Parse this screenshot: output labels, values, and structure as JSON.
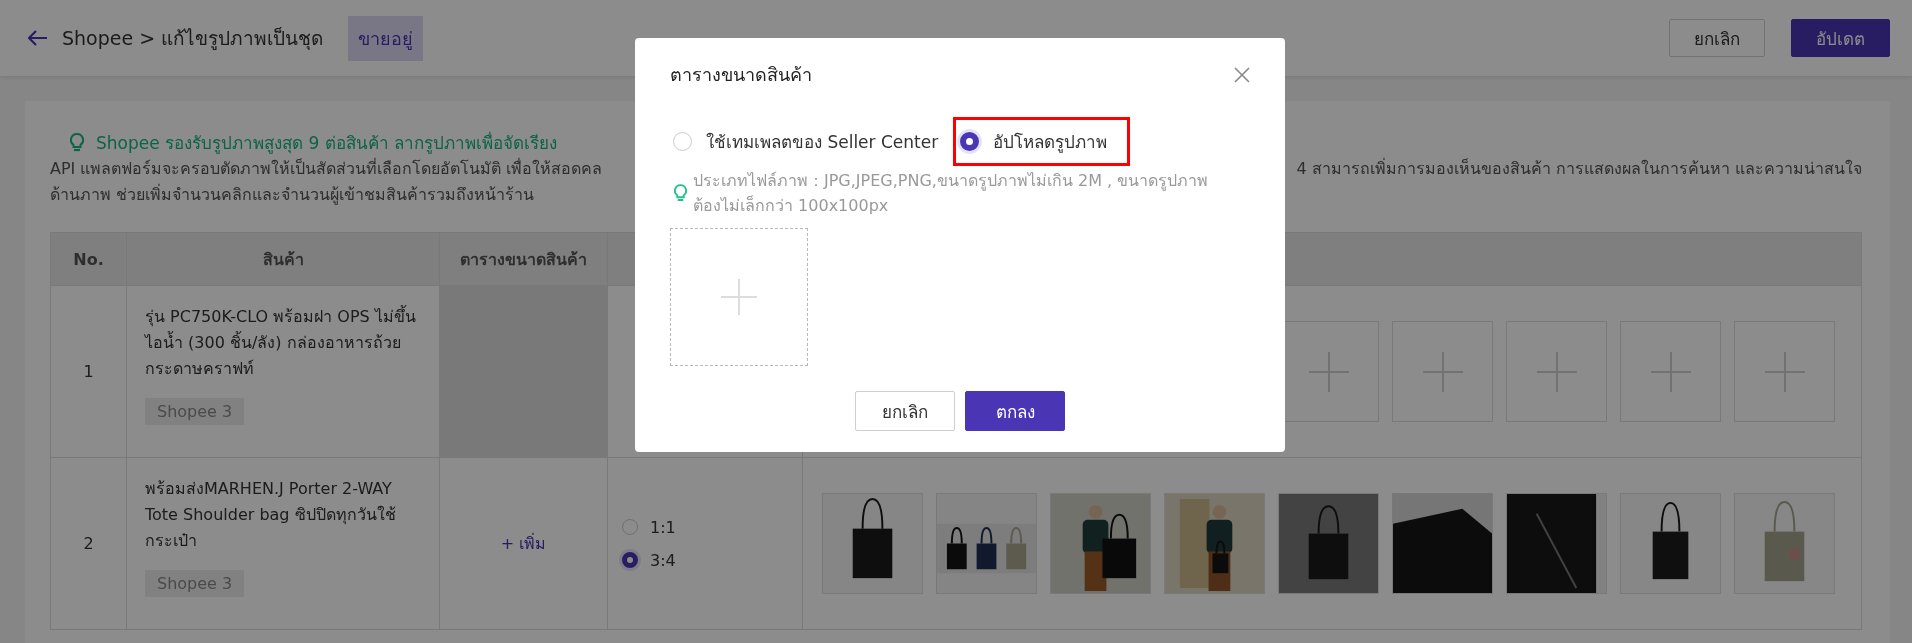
{
  "header": {
    "breadcrumb": "Shopee > แก้ไขรูปภาพเป็นชุด",
    "status": "ขายอยู่",
    "buttons": [
      {
        "label": "ยกเลิก",
        "kind": "secondary"
      },
      {
        "label": "อัปเดต",
        "kind": "primary"
      }
    ]
  },
  "notice": {
    "title": "Shopee รองรับรูปภาพสูงสุด 9 ต่อสินค้า ลากรูปภาพเพื่อจัดเรียง",
    "line_1_left": "API แพลตฟอร์มจะครอบตัดภาพให้เป็นสัดส่วนที่เลือกโดยอัตโนมัติ เพื่อให้สอดคล",
    "line_1_right": "4 สามารถเพิ่มการมองเห็นของสินค้า การแสดงผลในการค้นหา และความน่าสนใจ",
    "line_2": "ด้านภาพ ช่วยเพิ่มจำนวนคลิกและจำนวนผู้เข้าชมสินค้ารวมถึงหน้าร้าน"
  },
  "table": {
    "columns": [
      "No.",
      "สินค้า",
      "ตารางขนาดสินค้า"
    ],
    "rows": [
      {
        "no": "1",
        "name": "รุ่น PC750K-CLO พร้อมฝา OPS ไม่ขึ้นไอน้ำ (300 ชิ้น/ลัง) กล่องอาหารถ้วยกระดาษคราฟท์",
        "tag": "Shopee 3",
        "size_chart": {
          "highlighted": true
        },
        "images": [
          {
            "kind": "empty"
          },
          {
            "kind": "empty"
          },
          {
            "kind": "empty"
          },
          {
            "kind": "empty"
          },
          {
            "kind": "empty"
          }
        ]
      },
      {
        "no": "2",
        "name": "พร้อมส่งMARHEN.J Porter 2-WAY Tote Shoulder bag ซิปปิดทุกวันใช้กระเป๋า",
        "tag": "Shopee 3",
        "size_chart": {
          "highlighted": false,
          "add_label": "+ เพิ่ม"
        },
        "ratios": [
          {
            "label": "1:1",
            "selected": false
          },
          {
            "label": "3:4",
            "selected": true
          }
        ],
        "images": [
          {
            "kind": "picture"
          },
          {
            "kind": "picture"
          },
          {
            "kind": "picture"
          },
          {
            "kind": "picture"
          },
          {
            "kind": "picture"
          },
          {
            "kind": "picture"
          },
          {
            "kind": "picture"
          },
          {
            "kind": "picture"
          },
          {
            "kind": "picture"
          }
        ]
      }
    ]
  },
  "modal": {
    "title": "ตารางขนาดสินค้า",
    "options": [
      {
        "label": "ใช้เทมเพลตของ Seller Center",
        "selected": false,
        "highlighted": false
      },
      {
        "label": "อัปโหลดรูปภาพ",
        "selected": true,
        "highlighted": true
      }
    ],
    "hint": "ประเภทไฟล์ภาพ：JPG,JPEG,PNG,ขนาดรูปภาพไม่เกิน 2M , ขนาดรูปภาพต้องไม่เล็กกว่า 100x100px",
    "buttons": [
      {
        "label": "ยกเลิก",
        "kind": "secondary"
      },
      {
        "label": "ตกลง",
        "kind": "primary"
      }
    ]
  }
}
